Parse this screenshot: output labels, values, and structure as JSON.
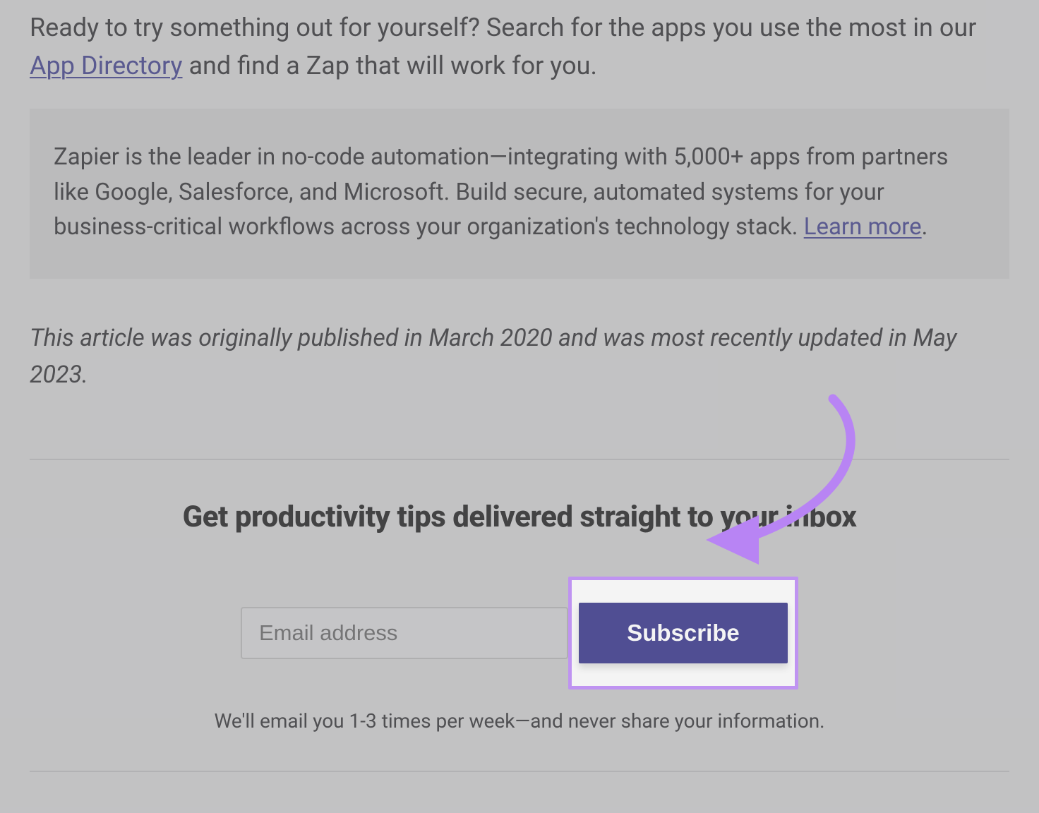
{
  "intro": {
    "text_before": "Ready to try something out for yourself? Search for the apps you use the most in our ",
    "link_text": "App Directory",
    "text_after": " and find a Zap that will work for you."
  },
  "callout": {
    "text_before": "Zapier is the leader in no-code automation—integrating with 5,000+ apps from partners like Google, Salesforce, and Microsoft. Build secure, automated systems for your business-critical workflows across your organization's technology stack. ",
    "link_text": "Learn more",
    "text_after": "."
  },
  "publication_note": "This article was originally published in March 2020 and was most recently updated in May 2023.",
  "subscribe": {
    "heading": "Get productivity tips delivered straight to your inbox",
    "email_placeholder": "Email address",
    "button_label": "Subscribe",
    "caption": "We'll email you 1-3 times per week—and never share your information."
  },
  "colors": {
    "link": "#4a4a8a",
    "button_bg": "#3f3d8e",
    "highlight_border": "#c18efc"
  }
}
